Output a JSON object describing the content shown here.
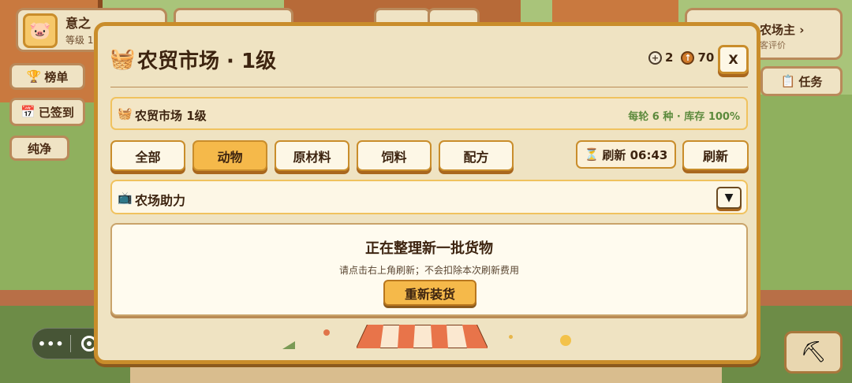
{
  "hud": {
    "user_name": "意之",
    "user_level": "等级 1",
    "leaderboard_label": "榜单",
    "checkin_label": "已签到",
    "pure_label": "纯净",
    "farmer_title": "农场主 ›",
    "farmer_sub": "客评价",
    "task_label": "任务"
  },
  "modal": {
    "title": "农贸市场 · 1级",
    "coins": {
      "silver": "2",
      "copper": "70"
    },
    "close_label": "X",
    "info_label": "农贸市场 1级",
    "info_meta": "每轮 6 种 · 库存 100%",
    "tabs": [
      {
        "label": "全部",
        "active": false
      },
      {
        "label": "动物",
        "active": true
      },
      {
        "label": "原材料",
        "active": false
      },
      {
        "label": "饲料",
        "active": false
      },
      {
        "label": "配方",
        "active": false
      }
    ],
    "timer_label": "刷新 06:43",
    "refresh_label": "刷新",
    "assist_label": "农场助力",
    "restock": {
      "heading": "正在整理新一批货物",
      "sub": "请点击右上角刷新；不会扣除本次刷新费用",
      "button": "重新装货"
    }
  },
  "colors": {
    "modal_border": "#c98d2b",
    "active_tab": "#f5b94a",
    "meta_green": "#5c8a3c"
  }
}
